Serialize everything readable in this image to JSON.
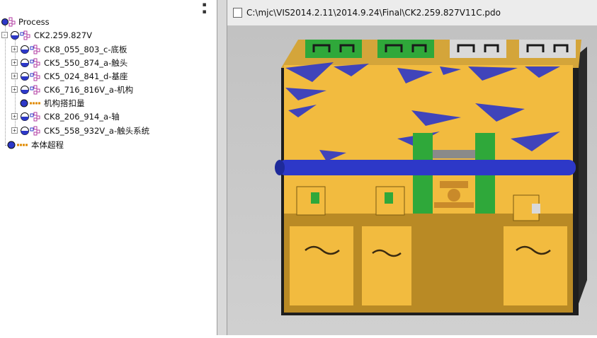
{
  "tree": {
    "root_label": "Process",
    "items": [
      {
        "label": "CK2.259.827V",
        "expander": "-"
      },
      {
        "label": "CK8_055_803_c-底板",
        "expander": "+"
      },
      {
        "label": "CK5_550_874_a-触头",
        "expander": "+"
      },
      {
        "label": "CK5_024_841_d-基座",
        "expander": "+"
      },
      {
        "label": "CK6_716_816V_a-机构",
        "expander": "+"
      },
      {
        "label": "机构搭扣量",
        "expander": ""
      },
      {
        "label": "CK8_206_914_a-轴",
        "expander": "+"
      },
      {
        "label": "CK5_558_932V_a-触头系统",
        "expander": "+"
      },
      {
        "label": "本体超程",
        "expander": ""
      }
    ]
  },
  "viewer": {
    "file_path": "C:\\mjc\\VIS2014.2.11\\2014.9.24\\Final\\CK2.259.827V11C.pdo"
  },
  "colors": {
    "part_yellow": "#f2bb3f",
    "part_blue": "#2d38c8",
    "part_green": "#2fa83a",
    "gear_orange": "#c98a2a",
    "background_gray": "#c4c4c4"
  },
  "icons": [
    "pin-icon",
    "process-icon",
    "assembly-icon",
    "measure-icon",
    "expand-icon",
    "collapse-icon",
    "pdo-file-icon"
  ]
}
